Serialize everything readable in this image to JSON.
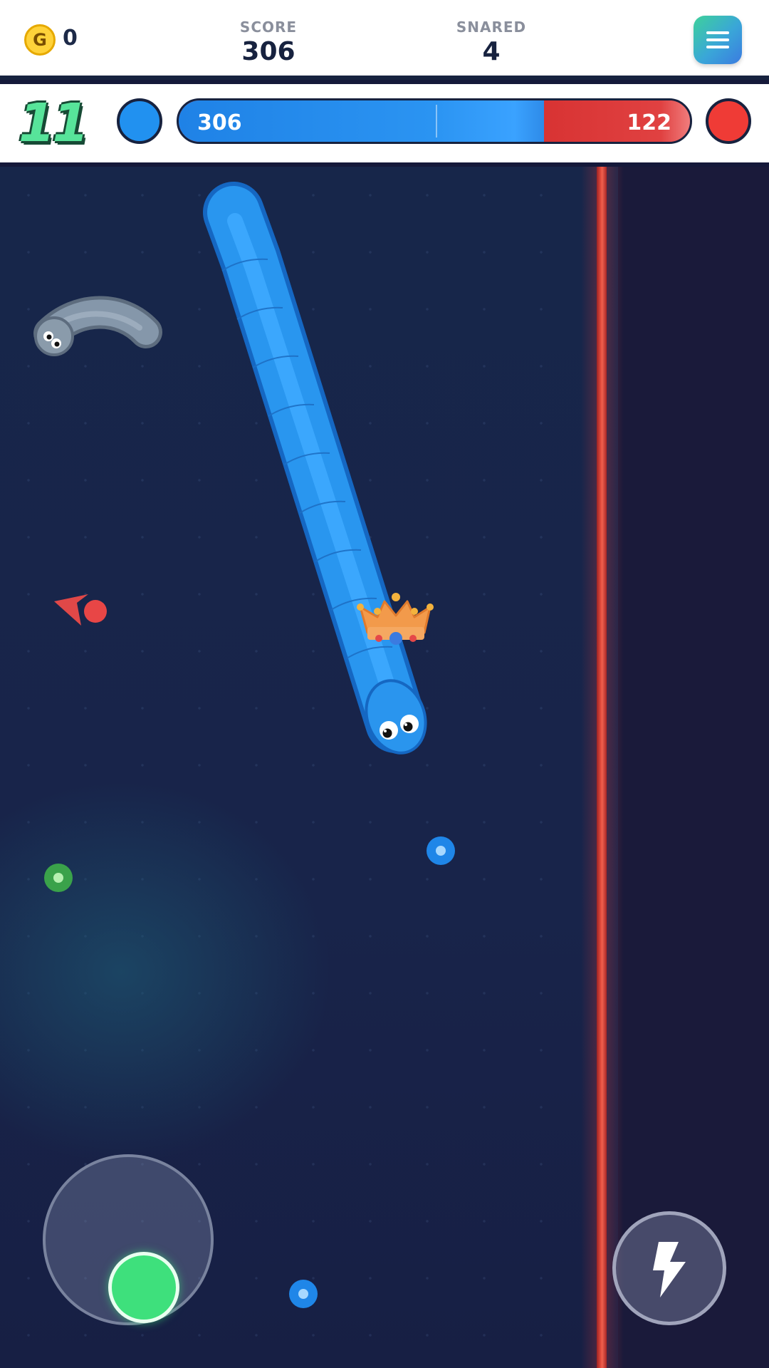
{
  "hud": {
    "coin_symbol": "G",
    "coins": "0",
    "score_label": "SCORE",
    "score_value": "306",
    "snared_label": "SNARED",
    "snared_value": "4",
    "menu_icon": "hamburger-menu-icon"
  },
  "match": {
    "timer": "11",
    "blue_team_score": "306",
    "red_team_score": "122",
    "blue_share": 0.715,
    "blue_color": "#2191f0",
    "red_color": "#ef3b36"
  },
  "arena": {
    "border_color": "#e24a3c",
    "player_snake_color": "#2191f0",
    "enemy_snake_color": "#7d8fa3",
    "leader_icon": "crown-icon",
    "offscreen_indicator_icon": "red-arrow-indicator-icon"
  },
  "controls": {
    "joystick_icon": "joystick-icon",
    "boost_icon": "lightning-icon",
    "knob_color": "#3ee07c"
  }
}
